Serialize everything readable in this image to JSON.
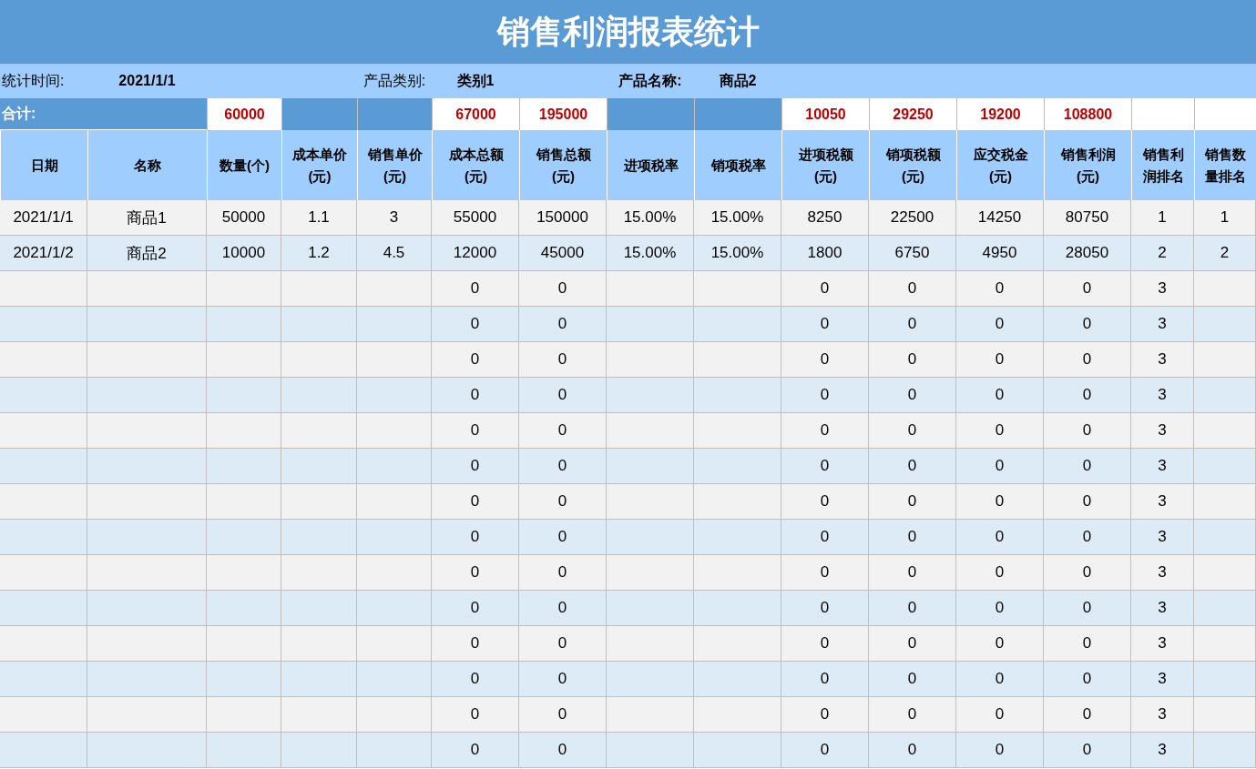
{
  "title": "销售利润报表统计",
  "info": [
    {
      "label": "统计时间:",
      "label_bold": false,
      "value": "2021/1/1"
    },
    {
      "label": "产品类别:",
      "label_bold": false,
      "value": "类别1"
    },
    {
      "label": "产品名称:",
      "label_bold": true,
      "value": "商品2"
    }
  ],
  "total": {
    "label": "合计:",
    "cells": [
      {
        "kind": "value",
        "text": "60000"
      },
      {
        "kind": "gap"
      },
      {
        "kind": "gap"
      },
      {
        "kind": "value",
        "text": "67000"
      },
      {
        "kind": "value",
        "text": "195000"
      },
      {
        "kind": "gap"
      },
      {
        "kind": "gap"
      },
      {
        "kind": "value",
        "text": "10050"
      },
      {
        "kind": "value",
        "text": "29250"
      },
      {
        "kind": "value",
        "text": "19200"
      },
      {
        "kind": "value",
        "text": "108800"
      },
      {
        "kind": "blank"
      },
      {
        "kind": "blank"
      }
    ]
  },
  "columns": [
    "日期",
    "名称",
    "数量(个)",
    "成本单价(元)",
    "销售单价(元)",
    "成本总额(元)",
    "销售总额(元)",
    "进项税率",
    "销项税率",
    "进项税额(元)",
    "销项税额(元)",
    "应交税金(元)",
    "销售利润(元)",
    "销售利润排名",
    "销售数量排名"
  ],
  "rows": [
    [
      "2021/1/1",
      "商品1",
      "50000",
      "1.1",
      "3",
      "55000",
      "150000",
      "15.00%",
      "15.00%",
      "8250",
      "22500",
      "14250",
      "80750",
      "1",
      "1"
    ],
    [
      "2021/1/2",
      "商品2",
      "10000",
      "1.2",
      "4.5",
      "12000",
      "45000",
      "15.00%",
      "15.00%",
      "1800",
      "6750",
      "4950",
      "28050",
      "2",
      "2"
    ],
    [
      null,
      null,
      null,
      null,
      null,
      "0",
      "0",
      null,
      null,
      "0",
      "0",
      "0",
      "0",
      "3",
      null
    ],
    [
      null,
      null,
      null,
      null,
      null,
      "0",
      "0",
      null,
      null,
      "0",
      "0",
      "0",
      "0",
      "3",
      null
    ],
    [
      null,
      null,
      null,
      null,
      null,
      "0",
      "0",
      null,
      null,
      "0",
      "0",
      "0",
      "0",
      "3",
      null
    ],
    [
      null,
      null,
      null,
      null,
      null,
      "0",
      "0",
      null,
      null,
      "0",
      "0",
      "0",
      "0",
      "3",
      null
    ],
    [
      null,
      null,
      null,
      null,
      null,
      "0",
      "0",
      null,
      null,
      "0",
      "0",
      "0",
      "0",
      "3",
      null
    ],
    [
      null,
      null,
      null,
      null,
      null,
      "0",
      "0",
      null,
      null,
      "0",
      "0",
      "0",
      "0",
      "3",
      null
    ],
    [
      null,
      null,
      null,
      null,
      null,
      "0",
      "0",
      null,
      null,
      "0",
      "0",
      "0",
      "0",
      "3",
      null
    ],
    [
      null,
      null,
      null,
      null,
      null,
      "0",
      "0",
      null,
      null,
      "0",
      "0",
      "0",
      "0",
      "3",
      null
    ],
    [
      null,
      null,
      null,
      null,
      null,
      "0",
      "0",
      null,
      null,
      "0",
      "0",
      "0",
      "0",
      "3",
      null
    ],
    [
      null,
      null,
      null,
      null,
      null,
      "0",
      "0",
      null,
      null,
      "0",
      "0",
      "0",
      "0",
      "3",
      null
    ],
    [
      null,
      null,
      null,
      null,
      null,
      "0",
      "0",
      null,
      null,
      "0",
      "0",
      "0",
      "0",
      "3",
      null
    ],
    [
      null,
      null,
      null,
      null,
      null,
      "0",
      "0",
      null,
      null,
      "0",
      "0",
      "0",
      "0",
      "3",
      null
    ],
    [
      null,
      null,
      null,
      null,
      null,
      "0",
      "0",
      null,
      null,
      "0",
      "0",
      "0",
      "0",
      "3",
      null
    ],
    [
      null,
      null,
      null,
      null,
      null,
      "0",
      "0",
      null,
      null,
      "0",
      "0",
      "0",
      "0",
      "3",
      null
    ]
  ]
}
